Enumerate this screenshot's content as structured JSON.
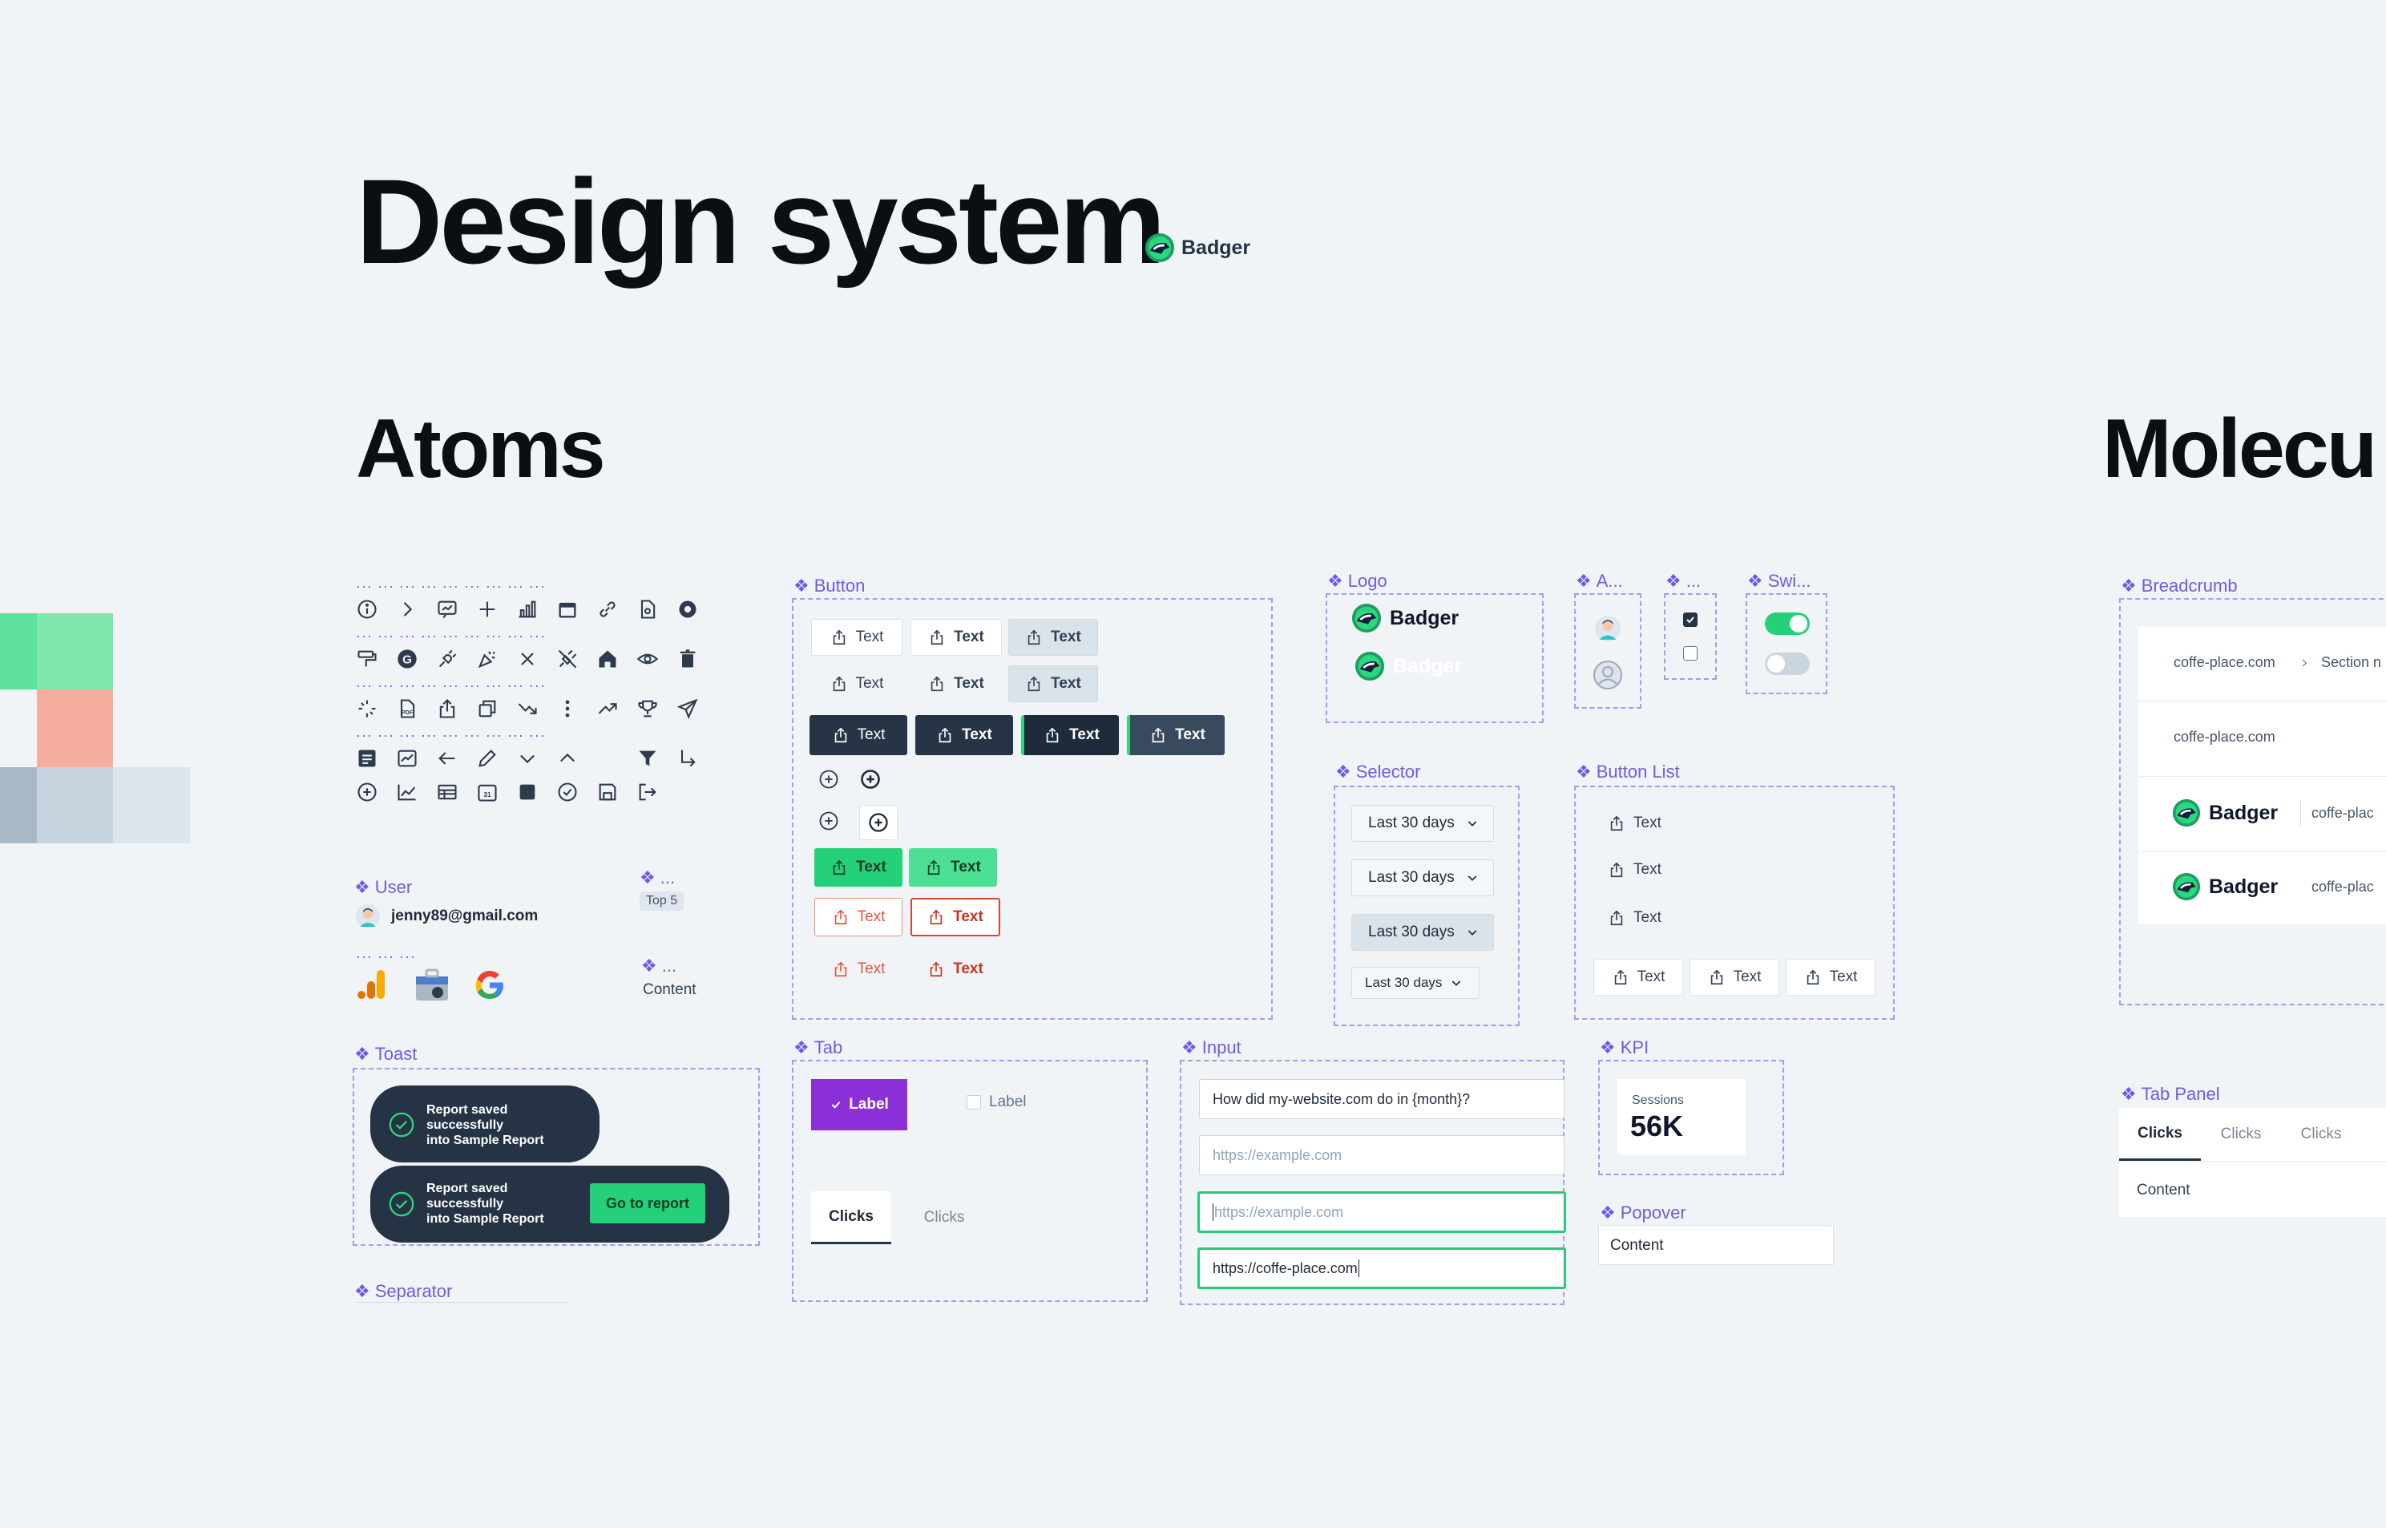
{
  "header": {
    "title": "Design system",
    "brand": "Badger"
  },
  "sections": {
    "atoms": "Atoms",
    "molecules": "Molecu"
  },
  "labels": {
    "button": "Button",
    "logo": "Logo",
    "avatar": "A...",
    "checkbox": "...",
    "switch": "Swi...",
    "breadcrumb": "Breadcrumb",
    "selector": "Selector",
    "button_list": "Button List",
    "user": "User",
    "top5": "...",
    "content_comp": "...",
    "toast": "Toast",
    "separator": "Separator",
    "tab": "Tab",
    "input": "Input",
    "kpi": "KPI",
    "popover": "Popover",
    "tab_panel": "Tab Panel"
  },
  "button": {
    "text": "Text"
  },
  "logo": {
    "name": "Badger",
    "name_inverse": "Badger"
  },
  "user": {
    "email": "jenny89@gmail.com"
  },
  "badge": {
    "top5": "Top 5"
  },
  "content": {
    "label": "Content"
  },
  "toast": {
    "line1": "Report saved",
    "line2": "successfully",
    "line3": "into Sample Report",
    "action": "Go to report"
  },
  "tab": {
    "selected_label": "Label",
    "unselected_label": "Label",
    "clicks_active": "Clicks",
    "clicks": "Clicks"
  },
  "input": {
    "question": "How did my-website.com do in {month}?",
    "placeholder": "https://example.com",
    "placeholder_focus": "https://example.com",
    "value": "https://coffe-place.com"
  },
  "selector": {
    "value": "Last 30 days"
  },
  "button_list": {
    "item": "Text"
  },
  "kpi": {
    "label": "Sessions",
    "value": "56K"
  },
  "popover": {
    "content": "Content"
  },
  "breadcrumb": {
    "domain": "coffe-place.com",
    "section": "Section n",
    "domain_single": "coffe-place.com",
    "logo": "Badger",
    "trail": "coffe-plac"
  },
  "tab_panel": {
    "tabs": [
      "Clicks",
      "Clicks",
      "Clicks"
    ],
    "content": "Content"
  },
  "colors": {
    "background": "#f0f4f7",
    "accent_purple": "#6b5ce7",
    "brand_green": "#25d07a",
    "dark": "#263345",
    "danger": "#e2573f"
  }
}
